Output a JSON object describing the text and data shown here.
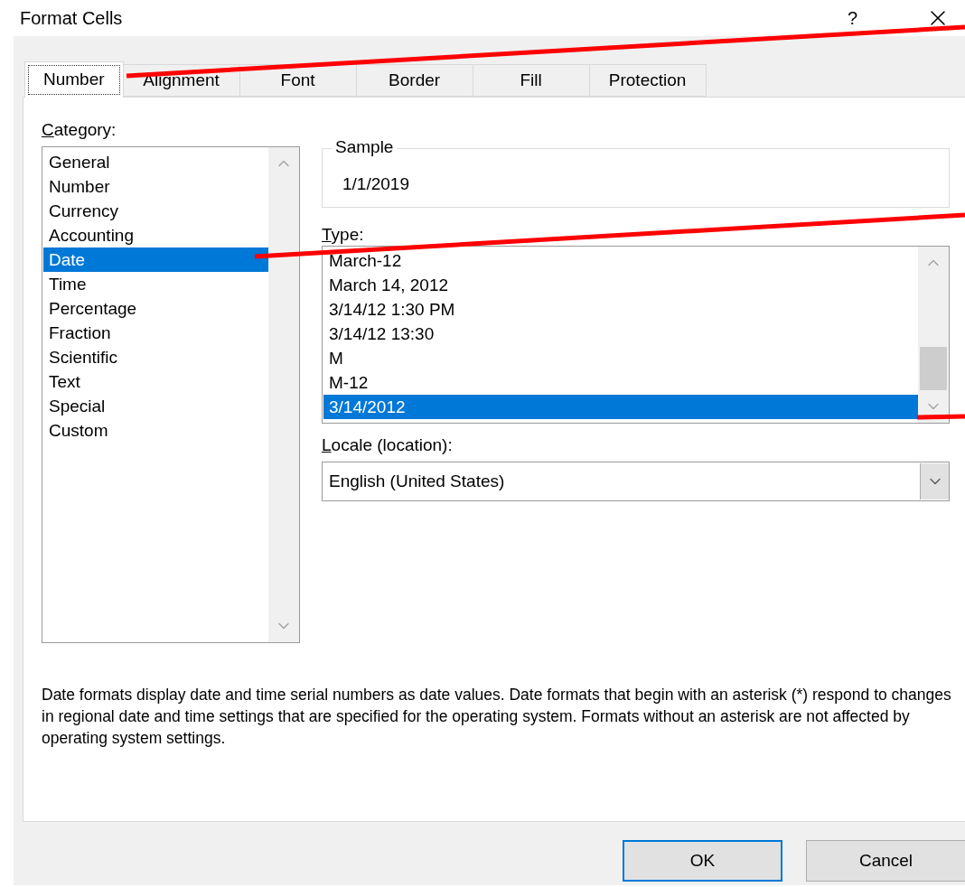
{
  "window": {
    "title": "Format Cells",
    "help": "?"
  },
  "tabs": [
    {
      "label": "Number",
      "selected": true
    },
    {
      "label": "Alignment",
      "selected": false
    },
    {
      "label": "Font",
      "selected": false
    },
    {
      "label": "Border",
      "selected": false
    },
    {
      "label": "Fill",
      "selected": false
    },
    {
      "label": "Protection",
      "selected": false
    }
  ],
  "category": {
    "label": "Category:",
    "items": [
      {
        "label": "General",
        "selected": false
      },
      {
        "label": "Number",
        "selected": false
      },
      {
        "label": "Currency",
        "selected": false
      },
      {
        "label": "Accounting",
        "selected": false
      },
      {
        "label": "Date",
        "selected": true
      },
      {
        "label": "Time",
        "selected": false
      },
      {
        "label": "Percentage",
        "selected": false
      },
      {
        "label": "Fraction",
        "selected": false
      },
      {
        "label": "Scientific",
        "selected": false
      },
      {
        "label": "Text",
        "selected": false
      },
      {
        "label": "Special",
        "selected": false
      },
      {
        "label": "Custom",
        "selected": false
      }
    ]
  },
  "sample": {
    "label": "Sample",
    "value": "1/1/2019"
  },
  "type": {
    "label": "Type:",
    "items": [
      {
        "label": "March-12",
        "selected": false
      },
      {
        "label": "March 14, 2012",
        "selected": false
      },
      {
        "label": "3/14/12 1:30 PM",
        "selected": false
      },
      {
        "label": "3/14/12 13:30",
        "selected": false
      },
      {
        "label": "M",
        "selected": false
      },
      {
        "label": "M-12",
        "selected": false
      },
      {
        "label": "3/14/2012",
        "selected": true
      }
    ]
  },
  "locale": {
    "label": "Locale (location):",
    "value": "English (United States)"
  },
  "description": "Date formats display date and time serial numbers as date values.  Date formats that begin with an asterisk (*) respond to changes in regional date and time settings that are specified for the operating system. Formats without an asterisk are not affected by operating system settings.",
  "buttons": [
    {
      "label": "OK",
      "default": true
    },
    {
      "label": "Cancel",
      "default": false
    }
  ]
}
